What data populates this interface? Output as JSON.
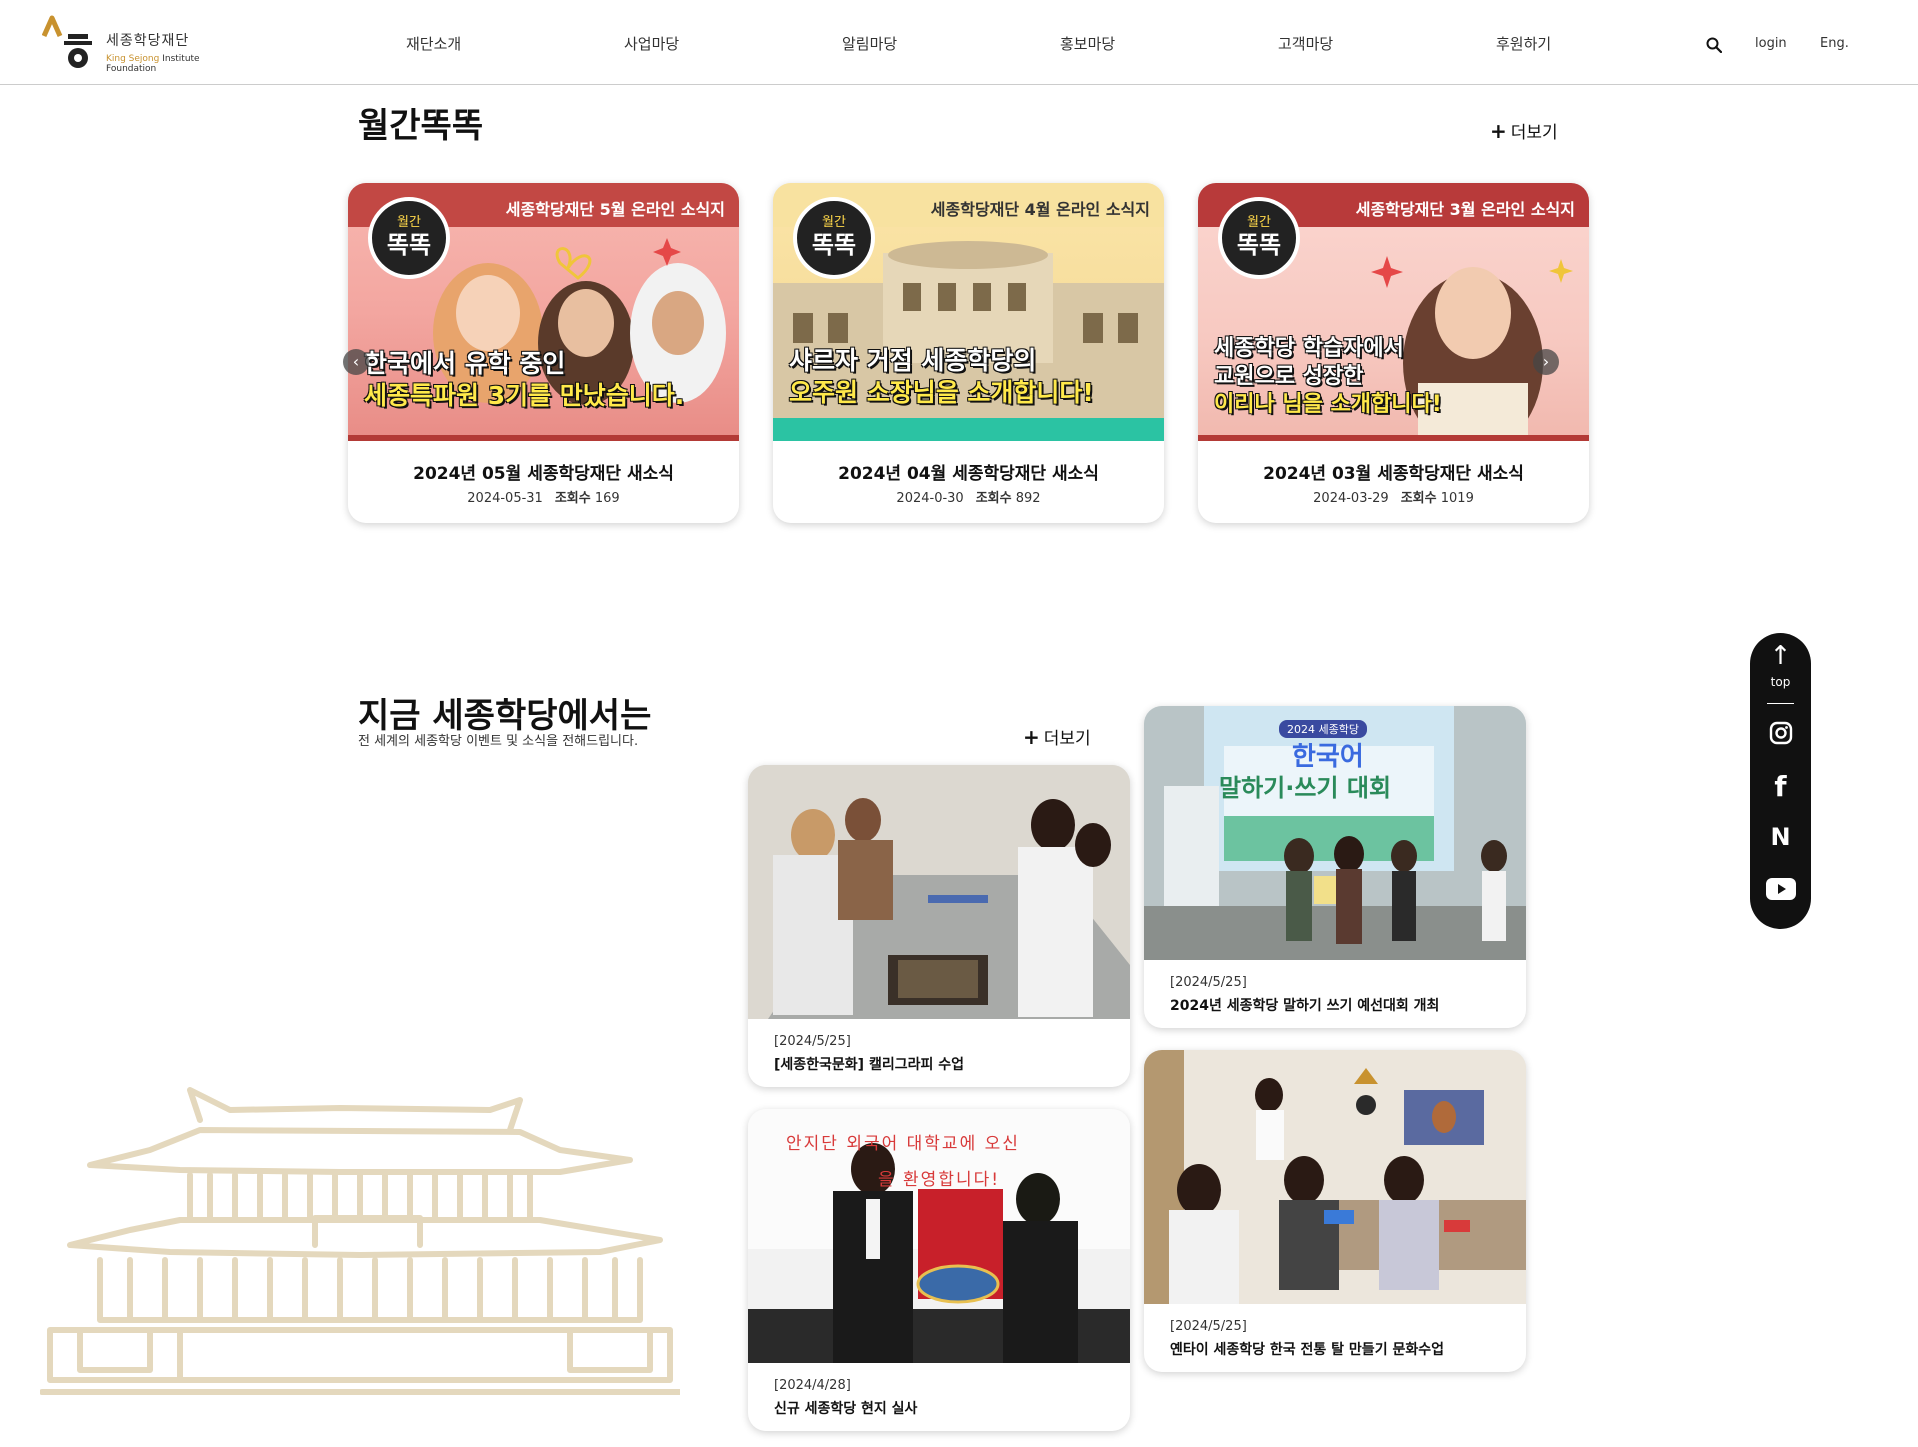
{
  "header": {
    "logo_ko": "세종학당재단",
    "logo_en_prefix": "King Sejong",
    "logo_en_rest": " Institute Foundation",
    "nav": [
      "재단소개",
      "사업마당",
      "알림마당",
      "홍보마당",
      "고객마당",
      "후원하기"
    ],
    "search_icon": "search-icon",
    "login": "login",
    "lang": "Eng."
  },
  "monthly": {
    "title": "월간똑똑",
    "more_plus": "+",
    "more_label": "더보기",
    "cards": [
      {
        "banner": "세종학당재단 5월 온라인 소식지",
        "badge_top": "월간",
        "badge_main": "똑똑",
        "headline_1": "한국에서 유학 중인",
        "headline_2": "세종특파원 3기를 만났습니다.",
        "title": "2024년 05월 세종학당재단 새소식",
        "date": "2024-05-31",
        "views_label": "조회수",
        "views": "169"
      },
      {
        "banner": "세종학당재단 4월 온라인 소식지",
        "badge_top": "월간",
        "badge_main": "똑똑",
        "headline_1": "샤르자 거점 세종학당의",
        "headline_2": "오주원 소장님을 소개합니다!",
        "title": "2024년 04월 세종학당재단 새소식",
        "date": "2024-0-30",
        "views_label": "조회수",
        "views": "892"
      },
      {
        "banner": "세종학당재단 3월 온라인 소식지",
        "badge_top": "월간",
        "badge_main": "똑똑",
        "headline_1": "세종학당 학습자에서",
        "headline_2": "교원으로 성장한",
        "headline_3": "이리나 님을 소개합니다!",
        "title": "2024년 03월 세종학당재단 새소식",
        "date": "2024-03-29",
        "views_label": "조회수",
        "views": "1019"
      }
    ],
    "prev_arrow": "‹",
    "next_arrow": "›"
  },
  "now": {
    "title": "지금 세종학당에서는",
    "subtitle": "전 세계의 세종학당 이벤트 및 소식을 전해드립니다.",
    "more_plus": "+",
    "more_label": "더보기",
    "items": [
      {
        "date": "[2024/5/25]",
        "title": "2024년 세종학당 말하기 쓰기 예선대회 개최",
        "photo_text_1": "2024 세종학당",
        "photo_text_2": "한국어",
        "photo_text_3": "말하기·쓰기 대회"
      },
      {
        "date": "[2024/5/25]",
        "title": "[세종한국문화] 캘리그라피 수업"
      },
      {
        "date": "[2024/5/25]",
        "title": "옌타이 세종학당 한국 전통 탈 만들기 문화수업"
      },
      {
        "date": "[2024/4/28]",
        "title": "신규 세종학당 현지 실사",
        "photo_text_1": "안지단 외국어 대학교에 오신",
        "photo_text_2": "을 환영합니다!"
      }
    ]
  },
  "sidebar": {
    "top_arrow": "↑",
    "top_label": "top",
    "instagram": "instagram-icon",
    "facebook": "f",
    "naver": "N",
    "youtube": "youtube-icon"
  },
  "colors": {
    "brand_gold": "#c8922f",
    "banner_red": "#b83a3a",
    "banner_yellow": "#f4d98a",
    "text_dark": "#111111",
    "temple_line": "#e4d8bd"
  }
}
